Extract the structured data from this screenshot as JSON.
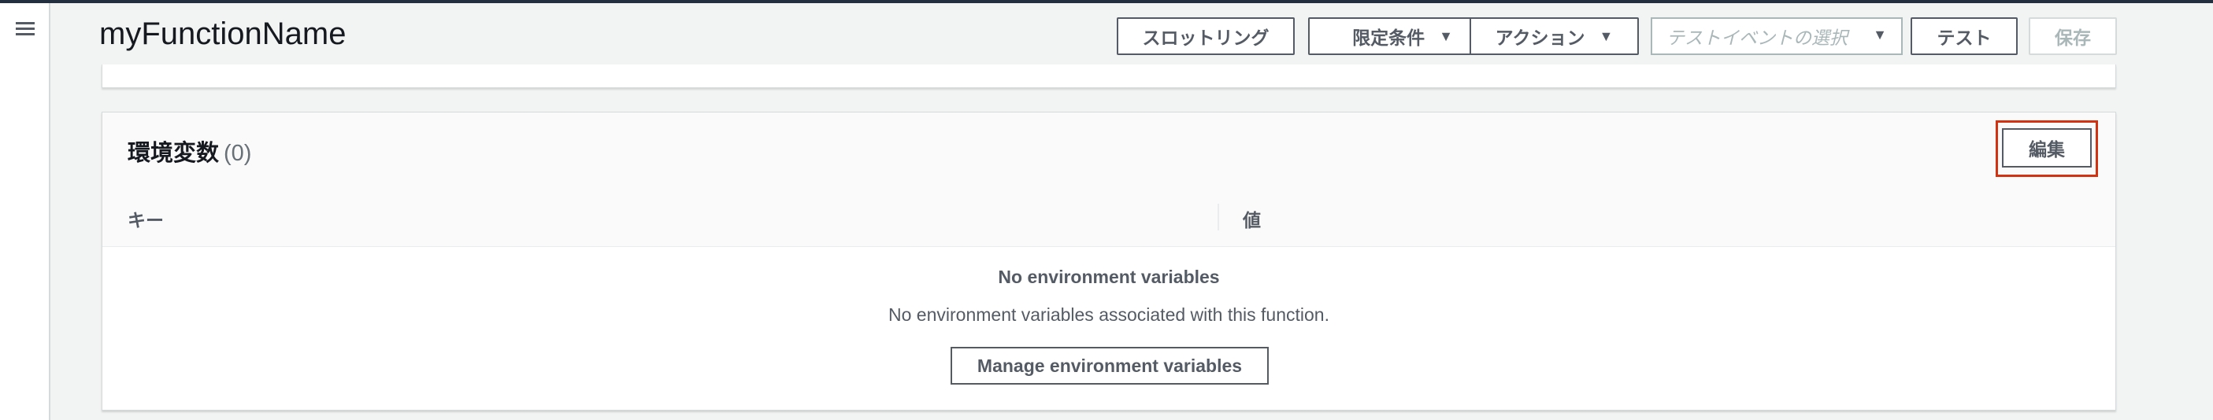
{
  "header": {
    "function_name": "myFunctionName",
    "buttons": {
      "throttling": "スロットリング",
      "qualifiers": "限定条件",
      "actions": "アクション",
      "test": "テスト",
      "save": "保存"
    },
    "test_event_select": {
      "placeholder": "テストイベントの選択"
    }
  },
  "environment_panel": {
    "title": "環境変数",
    "count": "(0)",
    "edit_label": "編集",
    "columns": {
      "key": "キー",
      "value": "値"
    },
    "empty": {
      "title": "No environment variables",
      "description": "No environment variables associated with this function.",
      "action_label": "Manage environment variables"
    }
  },
  "colors": {
    "highlight": "#d13212",
    "button_text": "#545b64",
    "background": "#f2f3f3"
  },
  "icons": {
    "menu": "hamburger-menu-icon",
    "dropdown": "caret-down-icon"
  }
}
